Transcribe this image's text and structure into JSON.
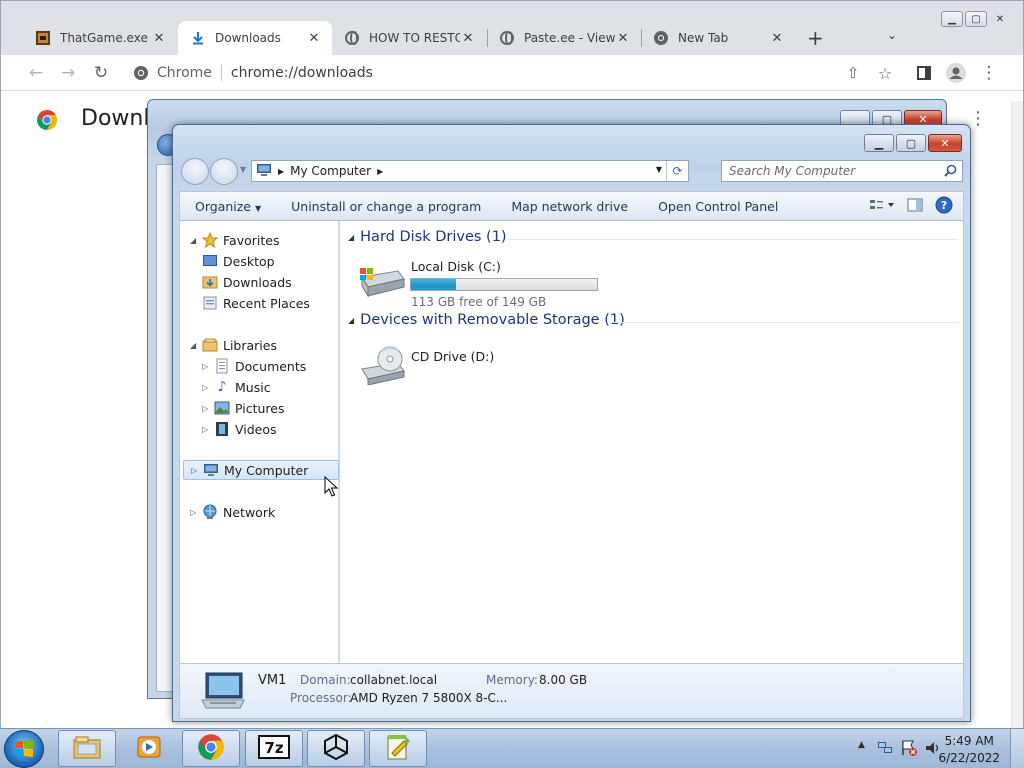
{
  "chrome": {
    "tabs": [
      {
        "label": "ThatGame.exe by",
        "icon": "game-icon",
        "active": false
      },
      {
        "label": "Downloads",
        "icon": "download-icon",
        "active": true
      },
      {
        "label": "HOW TO RESTO",
        "icon": "globe-icon",
        "active": false
      },
      {
        "label": "Paste.ee - View p",
        "icon": "globe-icon",
        "active": false
      },
      {
        "label": "New Tab",
        "icon": "chrome-icon",
        "active": false
      }
    ],
    "omnibox_site": "Chrome",
    "omnibox_url": "chrome://downloads",
    "page_title": "Downlo"
  },
  "explorer": {
    "address_location": "My Computer",
    "search_placeholder": "Search My Computer",
    "commands": [
      "Organize",
      "Uninstall or change a program",
      "Map network drive",
      "Open Control Panel"
    ],
    "nav": {
      "favorites": "Favorites",
      "desktop": "Desktop",
      "downloads": "Downloads",
      "recent": "Recent Places",
      "libraries": "Libraries",
      "documents": "Documents",
      "music": "Music",
      "pictures": "Pictures",
      "videos": "Videos",
      "mycomputer": "My Computer",
      "network": "Network"
    },
    "groups": {
      "hdd": "Hard Disk Drives (1)",
      "removable": "Devices with Removable Storage (1)"
    },
    "drives": {
      "c_name": "Local Disk (C:)",
      "c_space": "113 GB free of 149 GB",
      "c_used_fraction": 0.24,
      "d_name": "CD Drive (D:)"
    },
    "details": {
      "computer_name": "VM1",
      "domain_label": "Domain:",
      "domain_value": "collabnet.local",
      "memory_label": "Memory:",
      "memory_value": "8.00 GB",
      "processor_label": "Processor:",
      "processor_value": "AMD Ryzen 7 5800X 8-C..."
    }
  },
  "taskbar": {
    "time": "5:49 AM",
    "date": "6/22/2022"
  },
  "colors": {
    "group_header": "#1e3287",
    "drive_bar": "#26a1cf",
    "taskbar": "#a9c1dd"
  }
}
